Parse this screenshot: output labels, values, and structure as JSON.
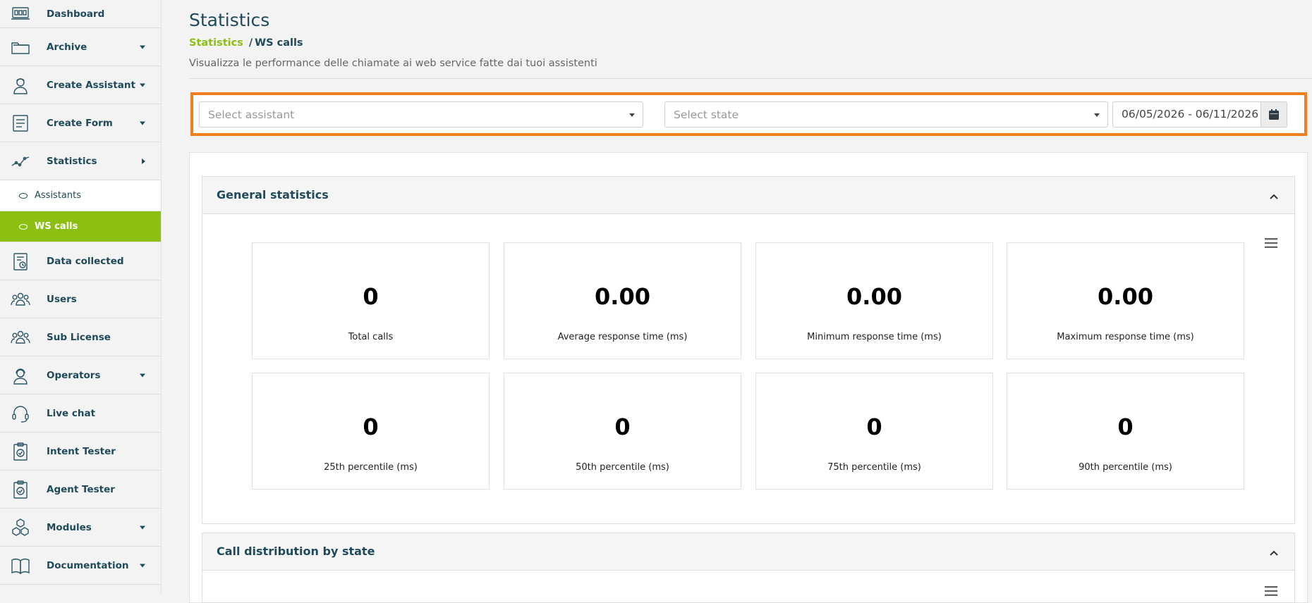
{
  "sidebar": {
    "items": [
      {
        "label": "Dashboard"
      },
      {
        "label": "Archive"
      },
      {
        "label": "Create Assistant"
      },
      {
        "label": "Create Form"
      },
      {
        "label": "Statistics"
      },
      {
        "label": "Assistants"
      },
      {
        "label": "WS calls"
      },
      {
        "label": "Data collected"
      },
      {
        "label": "Users"
      },
      {
        "label": "Sub License"
      },
      {
        "label": "Operators"
      },
      {
        "label": "Live chat"
      },
      {
        "label": "Intent Tester"
      },
      {
        "label": "Agent Tester"
      },
      {
        "label": "Modules"
      },
      {
        "label": "Documentation"
      }
    ]
  },
  "header": {
    "title": "Statistics",
    "breadcrumb_root": "Statistics",
    "breadcrumb_sep": "/",
    "breadcrumb_current": "WS calls",
    "subtitle": "Visualizza le performance delle chiamate ai web service fatte dai tuoi assistenti"
  },
  "filters": {
    "assistant_placeholder": "Select assistant",
    "state_placeholder": "Select state",
    "date_range": "06/05/2026 - 06/11/2026"
  },
  "general": {
    "title": "General statistics",
    "stats": [
      {
        "value": "0",
        "label": "Total calls"
      },
      {
        "value": "0.00",
        "label": "Average response time (ms)"
      },
      {
        "value": "0.00",
        "label": "Minimum response time (ms)"
      },
      {
        "value": "0.00",
        "label": "Maximum response time (ms)"
      },
      {
        "value": "0",
        "label": "25th percentile (ms)"
      },
      {
        "value": "0",
        "label": "50th percentile (ms)"
      },
      {
        "value": "0",
        "label": "75th percentile (ms)"
      },
      {
        "value": "0",
        "label": "90th percentile (ms)"
      }
    ]
  },
  "distribution": {
    "title": "Call distribution by state"
  },
  "colors": {
    "accent": "#8cbf12",
    "primary_text": "#1f4a5a",
    "highlight": "#f07f22"
  }
}
